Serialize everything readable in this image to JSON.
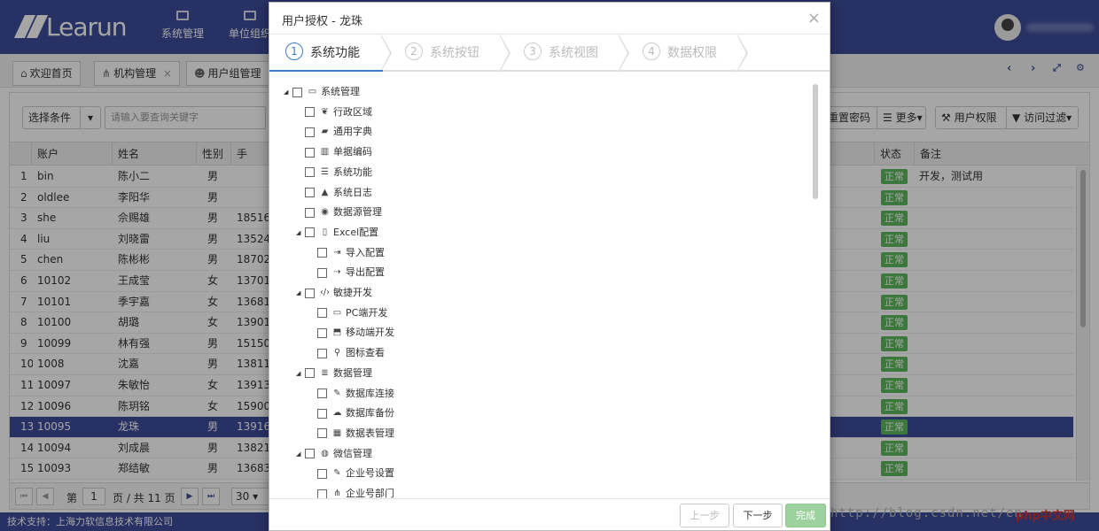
{
  "app": {
    "logo_text": "Learun",
    "footer": "技术支持：上海力软信息技术有限公司",
    "watermark": "http://blog.csdn.net/en",
    "php_logo": "php中文网"
  },
  "topnav": [
    {
      "label": "系统管理"
    },
    {
      "label": "单位组织"
    }
  ],
  "tabs": [
    {
      "label": "欢迎首页",
      "icon": "home-icon"
    },
    {
      "label": "机构管理",
      "icon": "sitemap-icon"
    },
    {
      "label": "用户组管理",
      "icon": "users-icon"
    }
  ],
  "toolbar": {
    "select_condition": "选择条件",
    "search_placeholder": "请输入要查询关键字",
    "reset_password": "重置密码",
    "more": "更多",
    "user_permission": "用户权限",
    "access_filter": "访问过滤"
  },
  "table": {
    "headers": [
      "账户",
      "姓名",
      "性别",
      "手",
      "状态",
      "备注"
    ],
    "rows": [
      {
        "n": "1",
        "account": "bin",
        "name": "陈小二",
        "gender": "男",
        "phone": "",
        "status": "正常",
        "note": "开发，测试用"
      },
      {
        "n": "2",
        "account": "oldlee",
        "name": "李阳华",
        "gender": "男",
        "phone": "",
        "status": "正常",
        "note": ""
      },
      {
        "n": "3",
        "account": "she",
        "name": "佘赐雄",
        "gender": "男",
        "phone": "18516",
        "status": "正常",
        "note": ""
      },
      {
        "n": "4",
        "account": "liu",
        "name": "刘晓雷",
        "gender": "男",
        "phone": "13524",
        "status": "正常",
        "note": ""
      },
      {
        "n": "5",
        "account": "chen",
        "name": "陈彬彬",
        "gender": "男",
        "phone": "18702",
        "status": "正常",
        "note": ""
      },
      {
        "n": "6",
        "account": "10102",
        "name": "王成莹",
        "gender": "女",
        "phone": "13701",
        "status": "正常",
        "note": ""
      },
      {
        "n": "7",
        "account": "10101",
        "name": "季宇嘉",
        "gender": "女",
        "phone": "13681",
        "status": "正常",
        "note": ""
      },
      {
        "n": "8",
        "account": "10100",
        "name": "胡璐",
        "gender": "女",
        "phone": "13901",
        "status": "正常",
        "note": ""
      },
      {
        "n": "9",
        "account": "10099",
        "name": "林有强",
        "gender": "男",
        "phone": "15150",
        "status": "正常",
        "note": ""
      },
      {
        "n": "10",
        "account": "1008",
        "name": "沈嘉",
        "gender": "男",
        "phone": "13811",
        "status": "正常",
        "note": ""
      },
      {
        "n": "11",
        "account": "10097",
        "name": "朱敏怡",
        "gender": "女",
        "phone": "13913",
        "status": "正常",
        "note": ""
      },
      {
        "n": "12",
        "account": "10096",
        "name": "陈玥铭",
        "gender": "女",
        "phone": "15900",
        "status": "正常",
        "note": ""
      },
      {
        "n": "13",
        "account": "10095",
        "name": "龙珠",
        "gender": "男",
        "phone": "13916",
        "status": "正常",
        "note": ""
      },
      {
        "n": "14",
        "account": "10094",
        "name": "刘成晨",
        "gender": "男",
        "phone": "13821",
        "status": "正常",
        "note": ""
      },
      {
        "n": "15",
        "account": "10093",
        "name": "郑结敏",
        "gender": "男",
        "phone": "13683",
        "status": "正常",
        "note": ""
      }
    ],
    "selected_row": 13
  },
  "pager": {
    "page_prefix": "第",
    "page": "1",
    "page_suffix": "页 / 共 11 页",
    "page_size": "30"
  },
  "modal": {
    "title": "用户授权 - 龙珠",
    "steps": [
      {
        "num": "1",
        "label": "系统功能"
      },
      {
        "num": "2",
        "label": "系统按钮"
      },
      {
        "num": "3",
        "label": "系统视图"
      },
      {
        "num": "4",
        "label": "数据权限"
      }
    ],
    "tree": [
      {
        "label": "系统管理",
        "level": 0,
        "toggle": true,
        "icon": "desktop-icon",
        "g": "▭"
      },
      {
        "label": "行政区域",
        "level": 1,
        "toggle": false,
        "icon": "leaf-icon",
        "g": "❦"
      },
      {
        "label": "通用字典",
        "level": 1,
        "toggle": false,
        "icon": "book-icon",
        "g": "▰"
      },
      {
        "label": "单据编码",
        "level": 1,
        "toggle": false,
        "icon": "barcode-icon",
        "g": "▥"
      },
      {
        "label": "系统功能",
        "level": 1,
        "toggle": false,
        "icon": "list-icon",
        "g": "☰"
      },
      {
        "label": "系统日志",
        "level": 1,
        "toggle": false,
        "icon": "warning-icon",
        "g": "▲"
      },
      {
        "label": "数据源管理",
        "level": 1,
        "toggle": false,
        "icon": "database-icon",
        "g": "◉"
      },
      {
        "label": "Excel配置",
        "level": 1,
        "toggle": true,
        "icon": "excel-file-icon",
        "g": "▯"
      },
      {
        "label": "导入配置",
        "level": 2,
        "toggle": false,
        "icon": "sign-in-icon",
        "g": "⇥"
      },
      {
        "label": "导出配置",
        "level": 2,
        "toggle": false,
        "icon": "share-icon",
        "g": "⇢"
      },
      {
        "label": "敏捷开发",
        "level": 1,
        "toggle": true,
        "icon": "code-icon",
        "g": "‹/›"
      },
      {
        "label": "PC端开发",
        "level": 2,
        "toggle": false,
        "icon": "monitor-icon",
        "g": "▭"
      },
      {
        "label": "移动端开发",
        "level": 2,
        "toggle": false,
        "icon": "html5-icon",
        "g": "⬒"
      },
      {
        "label": "图标查看",
        "level": 2,
        "toggle": false,
        "icon": "search-icon",
        "g": "⚲"
      },
      {
        "label": "数据管理",
        "level": 1,
        "toggle": true,
        "icon": "database-icon",
        "g": "≣"
      },
      {
        "label": "数据库连接",
        "level": 2,
        "toggle": false,
        "icon": "plug-icon",
        "g": "✎"
      },
      {
        "label": "数据库备份",
        "level": 2,
        "toggle": false,
        "icon": "cloud-upload-icon",
        "g": "☁"
      },
      {
        "label": "数据表管理",
        "level": 2,
        "toggle": false,
        "icon": "table-icon",
        "g": "▦"
      },
      {
        "label": "微信管理",
        "level": 1,
        "toggle": true,
        "icon": "wechat-icon",
        "g": "◍"
      },
      {
        "label": "企业号设置",
        "level": 2,
        "toggle": false,
        "icon": "plug-icon",
        "g": "✎"
      },
      {
        "label": "企业号部门",
        "level": 2,
        "toggle": false,
        "icon": "sitemap-icon",
        "g": "⋔"
      }
    ],
    "buttons": {
      "prev": "上一步",
      "next": "下一步",
      "finish": "完成"
    }
  },
  "colors": {
    "brand": "#3d4c99",
    "status_green": "#5cb85c",
    "step_active": "#3d7cc9"
  }
}
